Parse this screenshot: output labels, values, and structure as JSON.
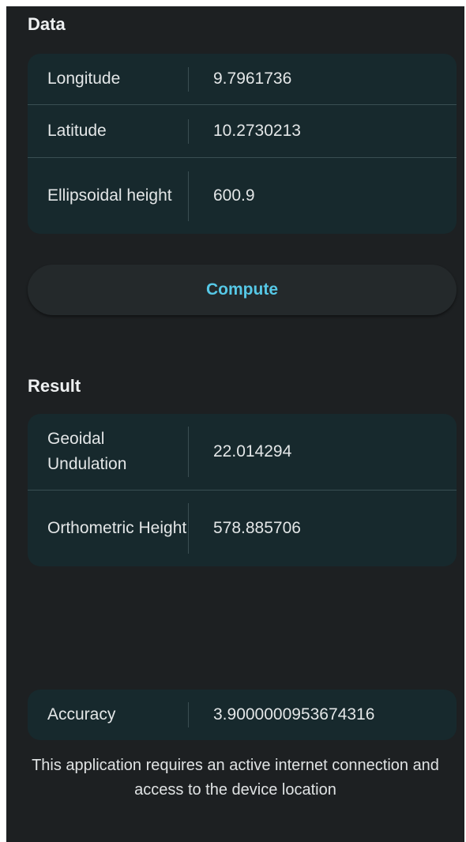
{
  "data_section": {
    "title": "Data",
    "rows": [
      {
        "label": "Longitude",
        "value": "9.7961736"
      },
      {
        "label": "Latitude",
        "value": "10.2730213"
      },
      {
        "label": "Ellipsoidal height",
        "value": "600.9"
      }
    ]
  },
  "compute_button": {
    "label": "Compute"
  },
  "result_section": {
    "title": "Result",
    "rows": [
      {
        "label": "Geoidal Undulation",
        "value": "22.014294"
      },
      {
        "label": "Orthometric Height",
        "value": "578.885706"
      }
    ]
  },
  "accuracy": {
    "label": "Accuracy",
    "value": "3.9000000953674316"
  },
  "footer_note": "This application requires an active internet connection and access to the device location",
  "colors": {
    "background": "#1d2022",
    "card": "#17292d",
    "accent": "#56c8e6"
  }
}
